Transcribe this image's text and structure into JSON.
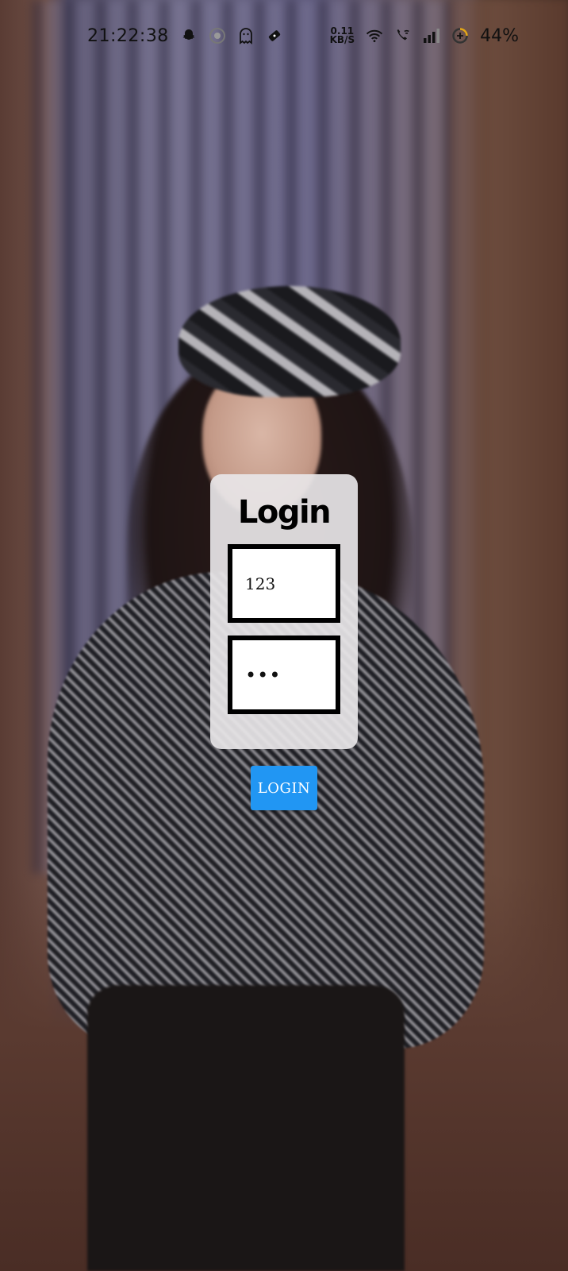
{
  "status_bar": {
    "time": "21:22:38",
    "net_speed_value": "0.11",
    "net_speed_unit": "KB/S",
    "battery_percent": "44%",
    "icons": [
      "snapchat-icon",
      "circle-app-icon",
      "ghost-icon",
      "ticket-icon",
      "wifi-icon",
      "wifi-call-icon",
      "signal-icon",
      "battery-icon"
    ]
  },
  "login": {
    "title": "Login",
    "username_value": "123",
    "password_value": "•••",
    "button_label": "LOGIN"
  },
  "colors": {
    "button_bg": "#2196f3",
    "card_bg": "#e8e6e8",
    "field_border": "#000000"
  }
}
